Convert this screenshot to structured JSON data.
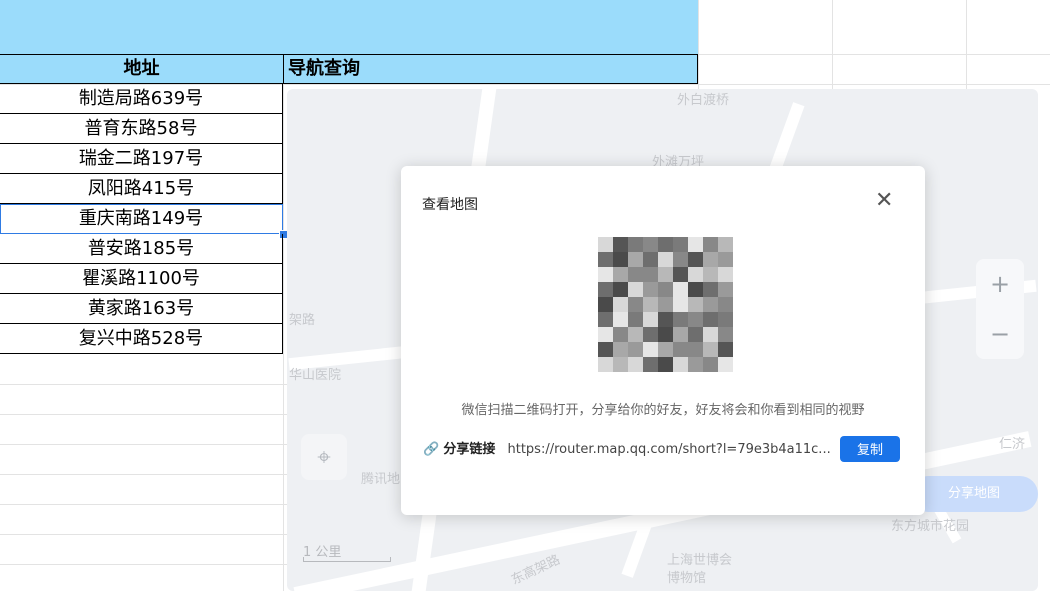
{
  "sheet": {
    "headers": {
      "address": "地址",
      "navigation": "导航查询"
    },
    "rows": [
      "制造局路639号",
      "普育东路58号",
      "瑞金二路197号",
      "凤阳路415号",
      "重庆南路149号",
      "普安路185号",
      "瞿溪路1100号",
      "黄家路163号",
      "复兴中路528号"
    ],
    "selected_row": 4,
    "header_color": "#9bdcfb",
    "selection_color": "#2f7be3"
  },
  "map": {
    "labels": {
      "top": "外白渡桥",
      "mid": "外滩万坪",
      "left_road": "架路",
      "hospital": "华山医院",
      "tencent": "腾讯地",
      "expo": "上海世博会",
      "expo2": "博物馆",
      "elevated": "东高架路",
      "garden": "东方城市花园",
      "renji": "仁济"
    },
    "zoom_in": "+",
    "zoom_out": "−",
    "locate_icon": "crosshair-icon",
    "share_map": "分享地图",
    "scale": "1 公里"
  },
  "modal": {
    "title": "查看地图",
    "close_icon": "close-icon",
    "description": "微信扫描二维码打开，分享给你的好友，好友将会和你看到相同的视野",
    "link_label": "分享链接",
    "link_icon": "link-icon",
    "link_url": "https://router.map.qq.com/short?l=79e3b4a11c...",
    "copy_label": "复制",
    "accent": "#1a73e8"
  }
}
